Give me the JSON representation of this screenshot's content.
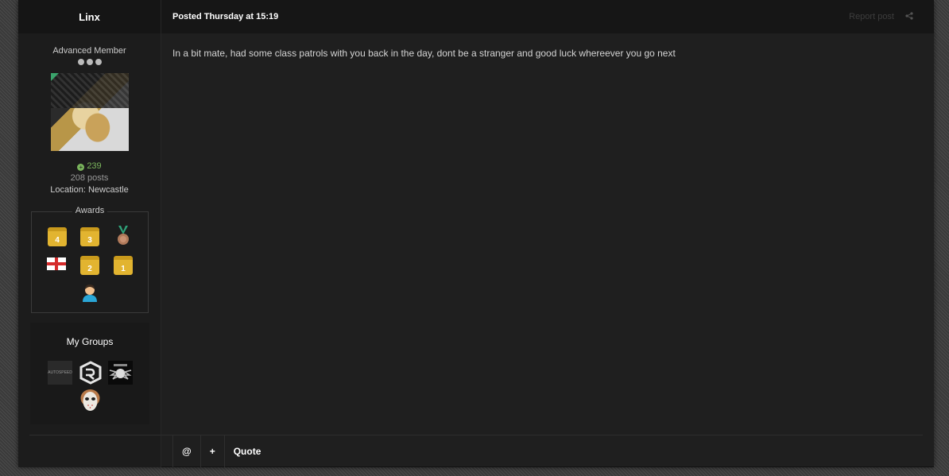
{
  "author": {
    "name": "Linx",
    "rank": "Advanced Member",
    "reputation": "239",
    "posts": "208 posts",
    "location": "Location: Newcastle"
  },
  "awards": {
    "title": "Awards",
    "items": [
      {
        "icon": "calendar-4-icon",
        "label": "4"
      },
      {
        "icon": "calendar-3-icon",
        "label": "3"
      },
      {
        "icon": "medal-icon"
      },
      {
        "icon": "england-flag-icon"
      },
      {
        "icon": "calendar-2-icon",
        "label": "2"
      },
      {
        "icon": "calendar-1-icon",
        "label": "1"
      },
      {
        "icon": "person-icon"
      }
    ]
  },
  "groups": {
    "title": "My Groups",
    "logo_text": "AUTOSPEED"
  },
  "post": {
    "posted": "Posted Thursday at 15:19",
    "report": "Report post",
    "body": "In a bit mate, had some class patrols with you back in the day, dont be a stranger and good luck whereever you go next"
  },
  "actions": {
    "mention": "@",
    "multiquote": "+",
    "quote": "Quote"
  },
  "colors": {
    "reputation": "#7ab55c",
    "award_gold": "#e2b430"
  }
}
